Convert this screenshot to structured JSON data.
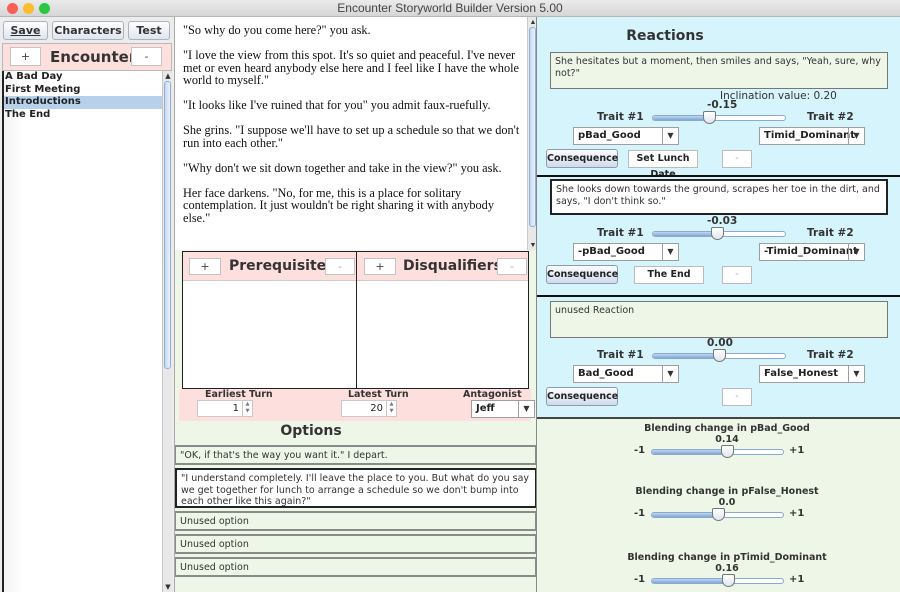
{
  "window": {
    "title": "Encounter Storyworld Builder Version 5.00"
  },
  "toolbar": {
    "save_label": "Save",
    "characters_label": "Characters",
    "test_label": "Test"
  },
  "encounters": {
    "title": "Encounters",
    "add_label": "+",
    "remove_label": "-",
    "items": [
      {
        "label": "A Bad Day",
        "selected": false
      },
      {
        "label": "First Meeting",
        "selected": false
      },
      {
        "label": "Introductions",
        "selected": true
      },
      {
        "label": "The End",
        "selected": false
      }
    ]
  },
  "story": {
    "paragraphs": [
      "\"So why do you come here?\" you ask.",
      "\"I love the view from this spot. It's so quiet and peaceful. I've never met or even heard anybody else here and I feel like I have the whole world to myself.\"",
      "\"It looks like I've ruined that for you\" you admit faux-ruefully.",
      "She grins. \"I suppose we'll have to set up a schedule so that we don't run into each other.\"",
      "\"Why don't we sit down together and take in the view?\" you ask.",
      "Her face darkens. \"No, for me, this is a place for solitary contemplation. It just wouldn't be right sharing it with anybody else.\""
    ]
  },
  "prerequisites": {
    "title": "Prerequisites",
    "add_label": "+",
    "remove_label": "-"
  },
  "disqualifiers": {
    "title": "Disqualifiers",
    "add_label": "+",
    "remove_label": "-"
  },
  "turns": {
    "earliest_label": "Earliest Turn",
    "earliest_value": "1",
    "latest_label": "Latest Turn",
    "latest_value": "20",
    "antagonist_label": "Antagonist",
    "antagonist_value": "Jeff"
  },
  "options": {
    "title": "Options",
    "items": [
      {
        "text": "\"OK, if that's the way you want it.\" I depart.",
        "selected": false
      },
      {
        "text": "\"I understand completely. I'll leave the place to you. But what do you say we get together for lunch to arrange a schedule so we don't bump into each other like this again?\"",
        "selected": true
      },
      {
        "text": "Unused option",
        "selected": false
      },
      {
        "text": "Unused option",
        "selected": false
      },
      {
        "text": "Unused option",
        "selected": false
      }
    ]
  },
  "reactions": {
    "title": "Reactions",
    "inclination_label": "Inclination value: 0.20",
    "trait1_label": "Trait #1",
    "trait2_label": "Trait #2",
    "consequence_label": "Consequence",
    "remove_label": "-",
    "items": [
      {
        "text": "She hesitates but a moment, then smiles and says, \"Yeah, sure, why not?\"",
        "slider_value": "-0.15",
        "slider_fraction": 0.425,
        "trait1": "pBad_Good",
        "trait2": "Timid_Dominant",
        "consequence_value": "Set Lunch Date"
      },
      {
        "text": "She looks down towards the ground, scrapes her toe in the dirt, and says, \"I don't think so.\"",
        "slider_value": "-0.03",
        "slider_fraction": 0.485,
        "trait1": "-pBad_Good",
        "trait2": "-Timid_Dominant",
        "consequence_value": "The End"
      },
      {
        "text": "unused Reaction",
        "slider_value": "0.00",
        "slider_fraction": 0.5,
        "trait1": "Bad_Good",
        "trait2": "False_Honest",
        "consequence_value": ""
      }
    ]
  },
  "blending": {
    "min_label": "-1",
    "max_label": "+1",
    "items": [
      {
        "label": "Blending change in pBad_Good",
        "value": "0.14",
        "fraction": 0.57
      },
      {
        "label": "Blending change in pFalse_Honest",
        "value": "0.0",
        "fraction": 0.5
      },
      {
        "label": "Blending change in pTimid_Dominant",
        "value": "0.16",
        "fraction": 0.58
      }
    ]
  }
}
